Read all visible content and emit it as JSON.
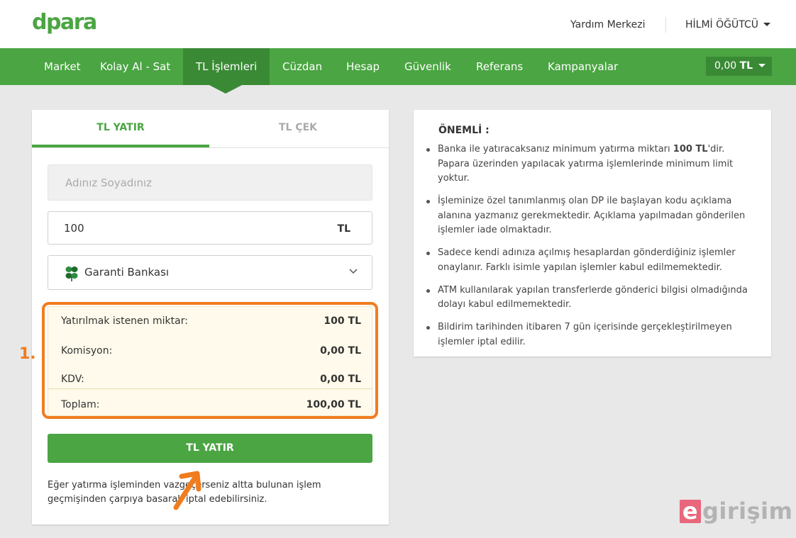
{
  "header": {
    "logo": "dpara",
    "help_link": "Yardım Merkezi",
    "user_name": "HİLMİ ÖĞÜTCÜ"
  },
  "nav": {
    "items": [
      "Market",
      "Kolay Al - Sat",
      "TL İşlemleri",
      "Cüzdan",
      "Hesap",
      "Güvenlik",
      "Referans",
      "Kampanyalar"
    ],
    "active": "TL İşlemleri",
    "balance_amount": "0,00",
    "balance_currency": "TL"
  },
  "form": {
    "tabs": [
      "TL YATIR",
      "TL ÇEK"
    ],
    "active_tab": "TL YATIR",
    "name_placeholder": "Adınız Soyadınız",
    "amount_value": "100",
    "amount_unit": "TL",
    "bank_selected": "Garanti Bankası",
    "summary": [
      {
        "label": "Yatırılmak istenen miktar:",
        "value": "100 TL"
      },
      {
        "label": "Komisyon:",
        "value": "0,00 TL"
      },
      {
        "label": "KDV:",
        "value": "0,00 TL"
      },
      {
        "label": "Toplam:",
        "value": "100,00 TL"
      }
    ],
    "submit_label": "TL YATIR",
    "note": "Eğer yatırma işleminden vazgeçerseniz altta bulunan işlem geçmişinden çarpıya basarak iptal edebilirsiniz."
  },
  "annotation": {
    "number": "1."
  },
  "info": {
    "title": "ÖNEMLİ :",
    "items": [
      {
        "before": "Banka ile yatıracaksanız minimum yatırma miktarı ",
        "bold": "100 TL",
        "after": "'dir. Papara üzerinden yapılacak yatırma işlemlerinde minimum limit yoktur."
      },
      {
        "before": "İşleminize özel tanımlanmış olan DP ile başlayan kodu açıklama alanına yazmanız gerekmektedir. Açıklama yapılmadan gönderilen işlemler iade olmaktadır.",
        "bold": "",
        "after": ""
      },
      {
        "before": "Sadece kendi adınıza açılmış hesaplardan gönderdiğiniz işlemler onaylanır. Farklı isimle yapılan işlemler kabul edilmemektedir.",
        "bold": "",
        "after": ""
      },
      {
        "before": "ATM kullanılarak yapılan transferlerde gönderici bilgisi olmadığında dolayı kabul edilmemektedir.",
        "bold": "",
        "after": ""
      },
      {
        "before": "Bildirim tarihinden itibaren 7 gün içerisinde gerçekleştirilmeyen işlemler iptal edilir.",
        "bold": "",
        "after": ""
      }
    ]
  },
  "watermark": {
    "first_letter": "e",
    "rest": "girişim"
  },
  "colors": {
    "brand_green": "#4aa542",
    "nav_active": "#3a8a35",
    "annotation_orange": "#f07c1e",
    "summary_bg": "#fffaeb"
  }
}
